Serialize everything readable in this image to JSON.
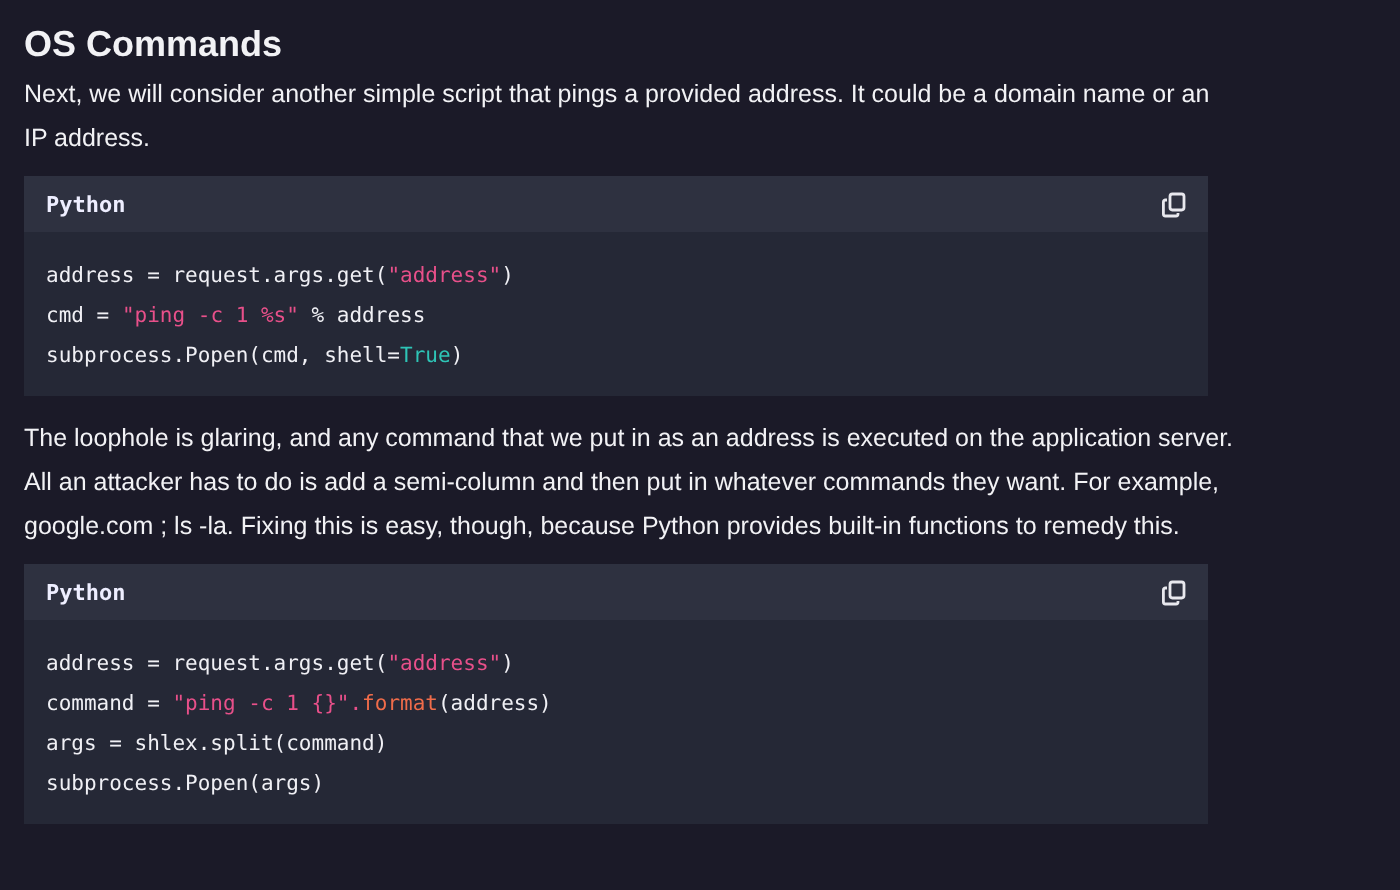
{
  "heading": "OS Commands",
  "blocks": [
    {
      "kind": "paragraph",
      "text": "Next, we will consider another simple script that pings a provided address. It could be a domain name or an IP address."
    },
    {
      "kind": "code",
      "language": "Python",
      "lines": [
        [
          {
            "text": "address = request.args.get(",
            "kind": "plain"
          },
          {
            "text": "\"address\"",
            "kind": "string"
          },
          {
            "text": ")",
            "kind": "plain"
          }
        ],
        [
          {
            "text": "cmd = ",
            "kind": "plain"
          },
          {
            "text": "\"ping -c 1 %s\"",
            "kind": "string"
          },
          {
            "text": " % address",
            "kind": "plain"
          }
        ],
        [
          {
            "text": "subprocess.Popen(cmd, shell=",
            "kind": "plain"
          },
          {
            "text": "True",
            "kind": "constant"
          },
          {
            "text": ")",
            "kind": "plain"
          }
        ]
      ]
    },
    {
      "kind": "paragraph",
      "text": "The loophole is glaring, and any command that we put in as an address is executed on the application server. All an attacker has to do is add a semi-column and then put in whatever commands they want. For example, google.com ; ls -la. Fixing this is easy, though, because Python provides built-in functions to remedy this."
    },
    {
      "kind": "code",
      "language": "Python",
      "lines": [
        [
          {
            "text": "address = request.args.get(",
            "kind": "plain"
          },
          {
            "text": "\"address\"",
            "kind": "string"
          },
          {
            "text": ")",
            "kind": "plain"
          }
        ],
        [
          {
            "text": "command = ",
            "kind": "plain"
          },
          {
            "text": "\"ping -c 1 {}\".",
            "kind": "string"
          },
          {
            "text": "format",
            "kind": "function"
          },
          {
            "text": "(address)",
            "kind": "plain"
          }
        ],
        [
          {
            "text": "args = shlex.split(command)",
            "kind": "plain"
          }
        ],
        [
          {
            "text": "subprocess.Popen(args)",
            "kind": "plain"
          }
        ]
      ]
    }
  ]
}
